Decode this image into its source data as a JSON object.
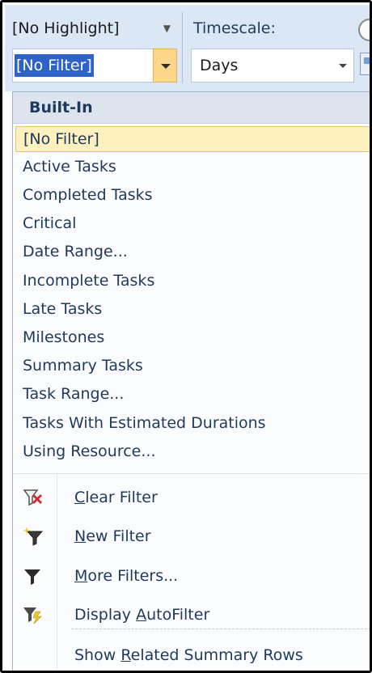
{
  "ribbon": {
    "highlight_value": "[No Highlight]",
    "timescale_label": "Timescale:",
    "filter_value": "[No Filter]",
    "timescale_value": "Days"
  },
  "filter_menu": {
    "section_title": "Built-In",
    "items": [
      {
        "label": "[No Filter]",
        "selected": true
      },
      {
        "label": "Active Tasks"
      },
      {
        "label": "Completed Tasks"
      },
      {
        "label": "Critical"
      },
      {
        "label": "Date Range..."
      },
      {
        "label": "Incomplete Tasks"
      },
      {
        "label": "Late Tasks"
      },
      {
        "label": "Milestones"
      },
      {
        "label": "Summary Tasks"
      },
      {
        "label": "Task Range..."
      },
      {
        "label": "Tasks With Estimated Durations"
      },
      {
        "label": "Using Resource..."
      }
    ],
    "commands": [
      {
        "icon": "clear-filter-icon",
        "label": "Clear Filter",
        "mnemonic": "C"
      },
      {
        "icon": "new-filter-icon",
        "label": "New Filter",
        "mnemonic": "N"
      },
      {
        "icon": "more-filters-icon",
        "label": "More Filters...",
        "mnemonic": "M"
      },
      {
        "icon": "autofilter-icon",
        "label": "Display AutoFilter",
        "mnemonic": "A"
      },
      {
        "icon": "",
        "label": "Show Related Summary Rows",
        "mnemonic": "R"
      }
    ]
  },
  "colors": {
    "ribbon_bg": "#dce7f5",
    "selection_blue": "#2d62c7",
    "hover_yellow": "#fff0bf",
    "text": "#1e395b"
  }
}
